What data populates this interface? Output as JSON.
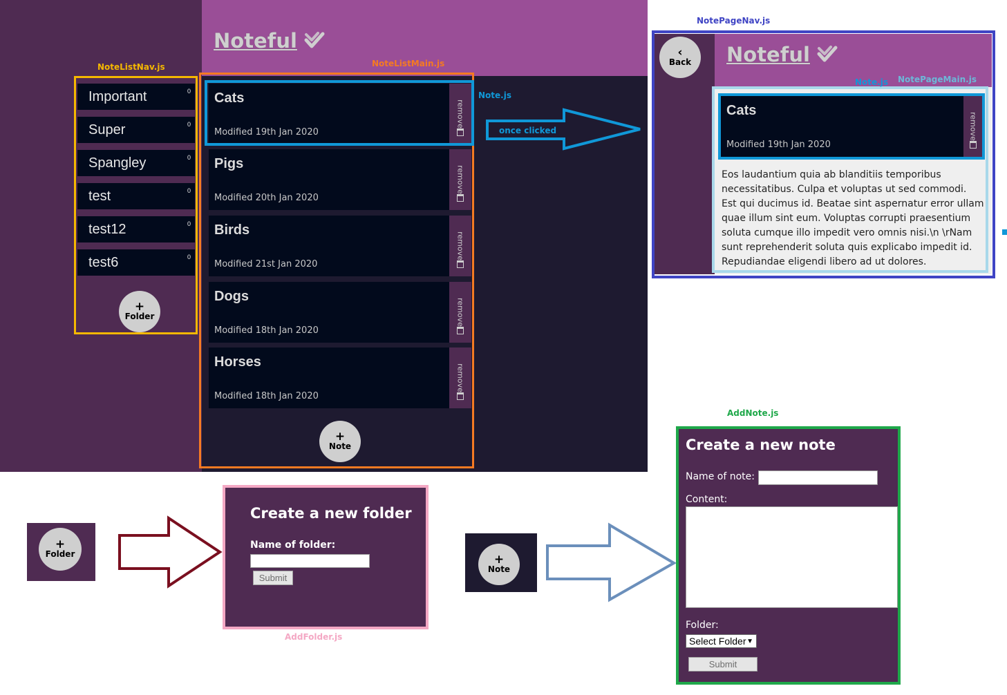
{
  "app": {
    "logo_text": "Noteful",
    "colors": {
      "nav": "#4f2b52",
      "header": "#9a4e97",
      "main": "#1e1a30",
      "card": "#020a1c",
      "button": "#cfcfcf"
    }
  },
  "folders": [
    {
      "name": "Important",
      "count": "0"
    },
    {
      "name": "Super",
      "count": "0"
    },
    {
      "name": "Spangley",
      "count": "0"
    },
    {
      "name": "test",
      "count": "0"
    },
    {
      "name": "test12",
      "count": "0"
    },
    {
      "name": "test6",
      "count": "0"
    }
  ],
  "add_folder_button": {
    "icon": "plus-icon",
    "plus": "+",
    "label": "Folder"
  },
  "notes": [
    {
      "title": "Cats",
      "modified": "Modified 19th Jan 2020",
      "remove_label": "remove"
    },
    {
      "title": "Pigs",
      "modified": "Modified 20th Jan 2020",
      "remove_label": "remove"
    },
    {
      "title": "Birds",
      "modified": "Modified 21st Jan 2020",
      "remove_label": "remove"
    },
    {
      "title": "Dogs",
      "modified": "Modified 18th Jan 2020",
      "remove_label": "remove"
    },
    {
      "title": "Horses",
      "modified": "Modified 18th Jan 2020",
      "remove_label": "remove"
    }
  ],
  "add_note_button": {
    "icon": "plus-icon",
    "plus": "+",
    "label": "Note"
  },
  "annotations": {
    "note_list_nav": {
      "text": "NoteListNav.js",
      "color": "#f5b800"
    },
    "note_list_main": {
      "text": "NoteListMain.js",
      "color": "#f57a22"
    },
    "note": {
      "text": "Note.js",
      "color": "#1098d8"
    },
    "once_clicked": {
      "text": "once clicked",
      "color": "#1098d8"
    },
    "note_page_nav": {
      "text": "NotePageNav.js",
      "color": "#3f44c4"
    },
    "note_page_note": {
      "text": "Note.js",
      "color": "#1098d8"
    },
    "note_page_main": {
      "text": "NotePageMain.js",
      "color": "#6cb8d8"
    },
    "add_folder": {
      "text": "AddFolder.js",
      "color": "#f4a8c4"
    },
    "add_note": {
      "text": "AddNote.js",
      "color": "#1fa84a"
    }
  },
  "note_page": {
    "back_icon": "chevron-left-icon",
    "back_glyph": "‹",
    "back_label": "Back",
    "note": {
      "title": "Cats",
      "modified": "Modified 19th Jan 2020",
      "remove_label": "remove"
    },
    "content": "Eos laudantium quia ab blanditiis temporibus necessitatibus. Culpa et voluptas ut sed commodi. Est qui ducimus id. Beatae sint aspernatur error ullam quae illum sint eum. Voluptas corrupti praesentium soluta cumque illo impedit vero omnis nisi.\\n \\rNam sunt reprehenderit soluta quis explicabo impedit id. Repudiandae eligendi libero ad ut dolores."
  },
  "add_folder_form": {
    "trigger": {
      "plus": "+",
      "label": "Folder"
    },
    "title": "Create a new folder",
    "name_label": "Name of folder:",
    "name_value": "",
    "submit_label": "Submit"
  },
  "add_note_form": {
    "trigger": {
      "plus": "+",
      "label": "Note"
    },
    "title": "Create a new note",
    "name_label": "Name of note:",
    "name_value": "",
    "content_label": "Content:",
    "content_value": "",
    "folder_label": "Folder:",
    "folder_selected": "Select Folder",
    "submit_label": "Submit"
  },
  "arrows": {
    "once_clicked_arrow": "#1098d8",
    "folder_arrow": "#7a0f1f",
    "note_arrow": "#6b8fbb"
  }
}
